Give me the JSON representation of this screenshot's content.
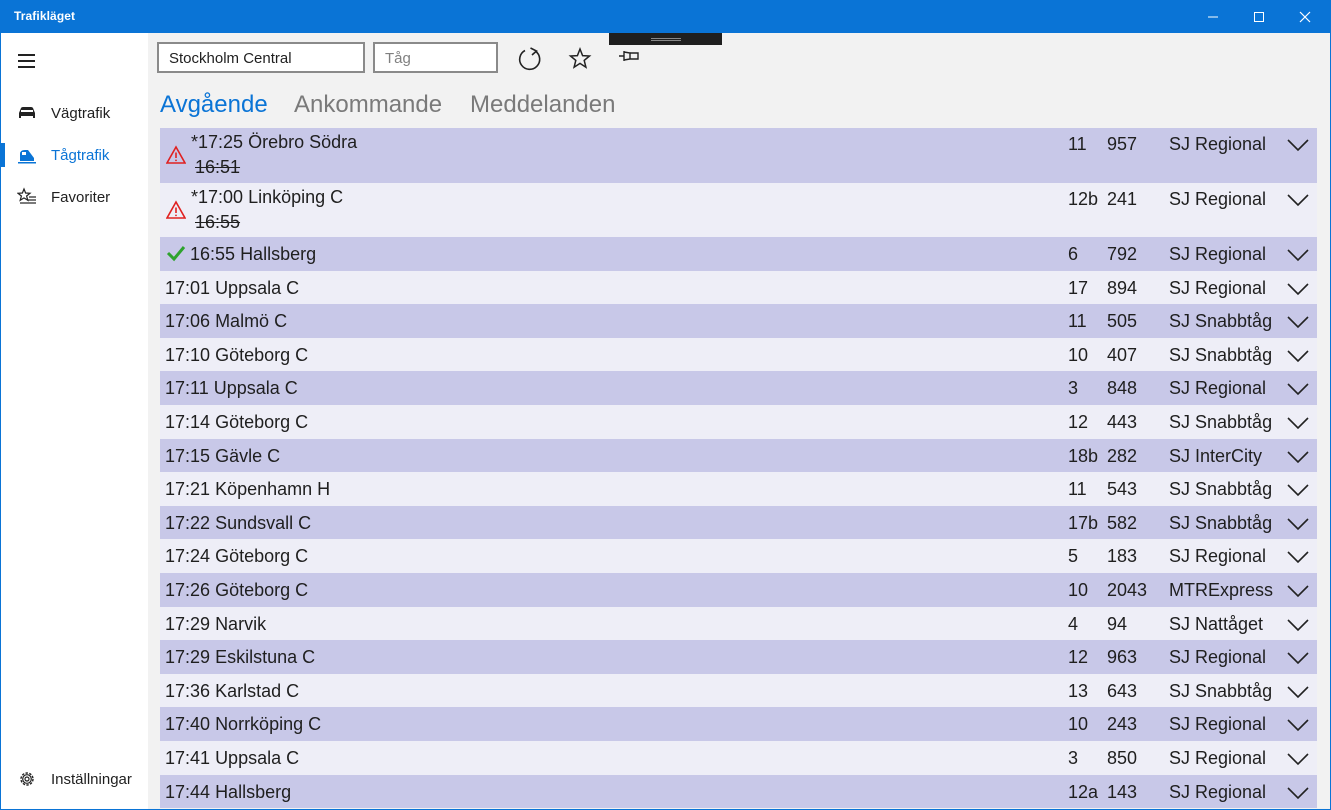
{
  "window": {
    "title": "Trafikläget"
  },
  "nav": {
    "items": [
      {
        "label": "Vägtrafik",
        "icon": "car-icon"
      },
      {
        "label": "Tågtrafik",
        "icon": "train-icon"
      },
      {
        "label": "Favoriter",
        "icon": "favorites-list-icon"
      }
    ],
    "settings_label": "Inställningar"
  },
  "search": {
    "station_value": "Stockholm Central",
    "train_placeholder": "Tåg"
  },
  "tabs": [
    "Avgående",
    "Ankommande",
    "Meddelanden"
  ],
  "colors": {
    "accent": "#0a74d6",
    "row_odd": "#c8c8e8",
    "row_even": "#eeeef7",
    "warning": "#e02020",
    "ok": "#2ea32e"
  },
  "departures": [
    {
      "time": "*17:25",
      "destination": "Örebro Södra",
      "old_time": "16:51",
      "status": "warning",
      "track": "11",
      "train": "957",
      "operator": "SJ Regional"
    },
    {
      "time": "*17:00",
      "destination": "Linköping C",
      "old_time": "16:55",
      "status": "warning",
      "track": "12b",
      "train": "241",
      "operator": "SJ Regional"
    },
    {
      "time": "16:55",
      "destination": "Hallsberg",
      "status": "ok",
      "track": "6",
      "train": "792",
      "operator": "SJ Regional"
    },
    {
      "time": "17:01",
      "destination": "Uppsala C",
      "track": "17",
      "train": "894",
      "operator": "SJ Regional"
    },
    {
      "time": "17:06",
      "destination": "Malmö C",
      "track": "11",
      "train": "505",
      "operator": "SJ Snabbtåg"
    },
    {
      "time": "17:10",
      "destination": "Göteborg C",
      "track": "10",
      "train": "407",
      "operator": "SJ Snabbtåg"
    },
    {
      "time": "17:11",
      "destination": "Uppsala C",
      "track": "3",
      "train": "848",
      "operator": "SJ Regional"
    },
    {
      "time": "17:14",
      "destination": "Göteborg C",
      "track": "12",
      "train": "443",
      "operator": "SJ Snabbtåg"
    },
    {
      "time": "17:15",
      "destination": "Gävle C",
      "track": "18b",
      "train": "282",
      "operator": "SJ InterCity"
    },
    {
      "time": "17:21",
      "destination": "Köpenhamn H",
      "track": "11",
      "train": "543",
      "operator": "SJ Snabbtåg"
    },
    {
      "time": "17:22",
      "destination": "Sundsvall C",
      "track": "17b",
      "train": "582",
      "operator": "SJ Snabbtåg"
    },
    {
      "time": "17:24",
      "destination": "Göteborg C",
      "track": "5",
      "train": "183",
      "operator": "SJ Regional"
    },
    {
      "time": "17:26",
      "destination": "Göteborg C",
      "track": "10",
      "train": "2043",
      "operator": "MTRExpress"
    },
    {
      "time": "17:29",
      "destination": "Narvik",
      "track": "4",
      "train": "94",
      "operator": "SJ Nattåget"
    },
    {
      "time": "17:29",
      "destination": "Eskilstuna C",
      "track": "12",
      "train": "963",
      "operator": "SJ Regional"
    },
    {
      "time": "17:36",
      "destination": "Karlstad C",
      "track": "13",
      "train": "643",
      "operator": "SJ Snabbtåg"
    },
    {
      "time": "17:40",
      "destination": "Norrköping C",
      "track": "10",
      "train": "243",
      "operator": "SJ Regional"
    },
    {
      "time": "17:41",
      "destination": "Uppsala C",
      "track": "3",
      "train": "850",
      "operator": "SJ Regional"
    },
    {
      "time": "17:44",
      "destination": "Hallsberg",
      "track": "12a",
      "train": "143",
      "operator": "SJ Regional"
    }
  ]
}
